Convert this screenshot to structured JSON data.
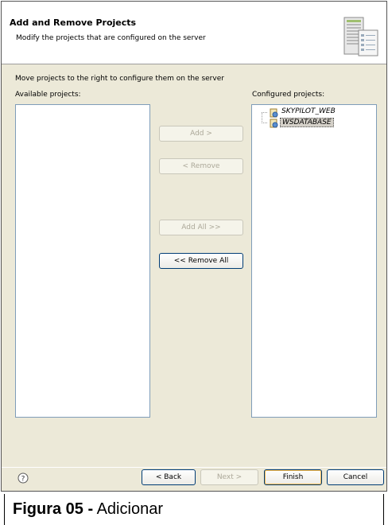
{
  "header": {
    "title": "Add and Remove Projects",
    "description": "Modify the projects that are configured on the server",
    "banner_icon": "server-config-icon"
  },
  "body": {
    "instruction": "Move projects to the right to configure them on the server",
    "available_label": "Available projects:",
    "configured_label": "Configured projects:",
    "available_projects": [],
    "configured_projects": [
      {
        "name": "SKYPILOT_WEB",
        "icon": "web-project-icon",
        "selected": false
      },
      {
        "name": "WSDATABASE",
        "icon": "web-project-icon",
        "selected": true
      }
    ]
  },
  "buttons": {
    "add": "Add >",
    "remove": "< Remove",
    "add_all": "Add All >>",
    "remove_all": "<< Remove All"
  },
  "footer": {
    "help_icon": "help-icon",
    "back": "< Back",
    "next": "Next >",
    "finish": "Finish",
    "cancel": "Cancel"
  },
  "caption": {
    "bold_part": "Figura 05  -",
    "text": "Adicionar"
  }
}
